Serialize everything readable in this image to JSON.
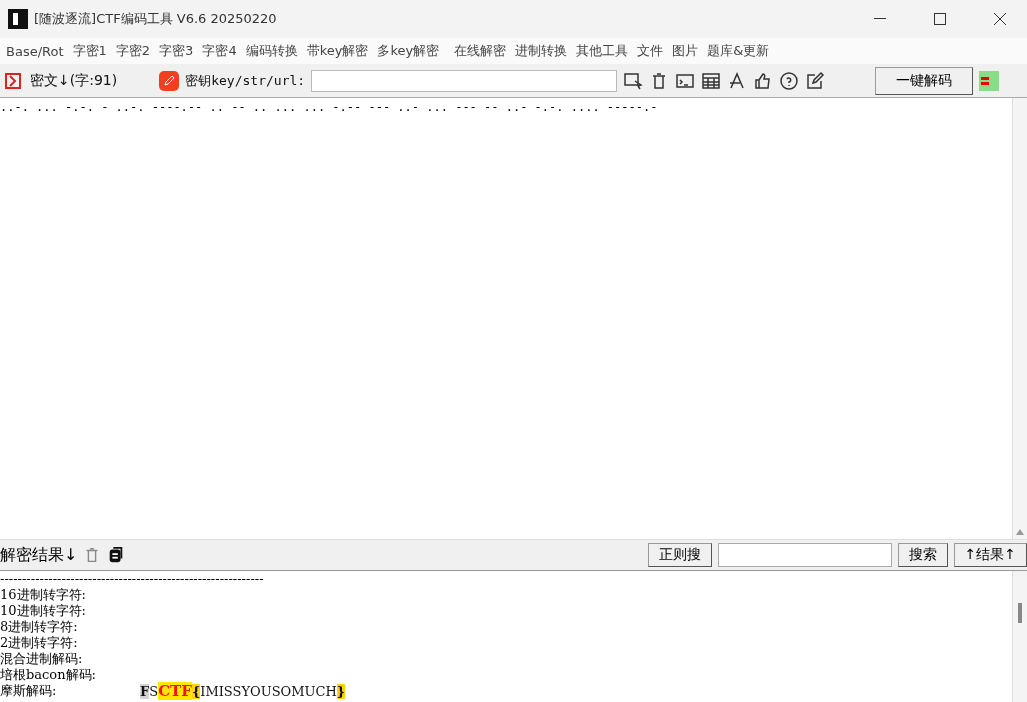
{
  "window": {
    "title": "[随波逐流]CTF编码工具 V6.6 20250220"
  },
  "menu": [
    "Base/Rot",
    "字密1",
    "字密2",
    "字密3",
    "字密4",
    "编码转换",
    "带key解密",
    "多key解密",
    "在线解密",
    "进制转换",
    "其他工具",
    "文件",
    "图片",
    "题库&更新"
  ],
  "toolbar": {
    "cipher_label": "密文↓(字:91)",
    "key_label": "密钥key/str/url:",
    "decode_button": "一键解码"
  },
  "ciphertext": "..-. ... -.-. - ..-. ----.-- .. -- .. ... ... -.-- --- ..- ... --- -- ..- -.-. .... -----.-",
  "result_bar": {
    "label": "解密结果↓",
    "regex_button": "正则搜",
    "search_button": "搜索",
    "results_button": "↑结果↑"
  },
  "results": {
    "separator": "------------------------------------------------------------",
    "rows": [
      {
        "label": "16进制转字符:"
      },
      {
        "label": "10进制转字符:"
      },
      {
        "label": "8进制转字符:"
      },
      {
        "label": "2进制转字符:"
      },
      {
        "label": "混合进制解码:"
      },
      {
        "label": "培根bacon解码:"
      },
      {
        "label": "摩斯解码:",
        "segments": [
          {
            "text": "F",
            "kind": "mark"
          },
          {
            "text": "S",
            "kind": "plain"
          },
          {
            "text": "CTF",
            "kind": "flag"
          },
          {
            "text": "{",
            "kind": "brace"
          },
          {
            "text": "IMISSYOUSOMUCH",
            "kind": "plain"
          },
          {
            "text": "}",
            "kind": "brace"
          }
        ]
      }
    ]
  }
}
